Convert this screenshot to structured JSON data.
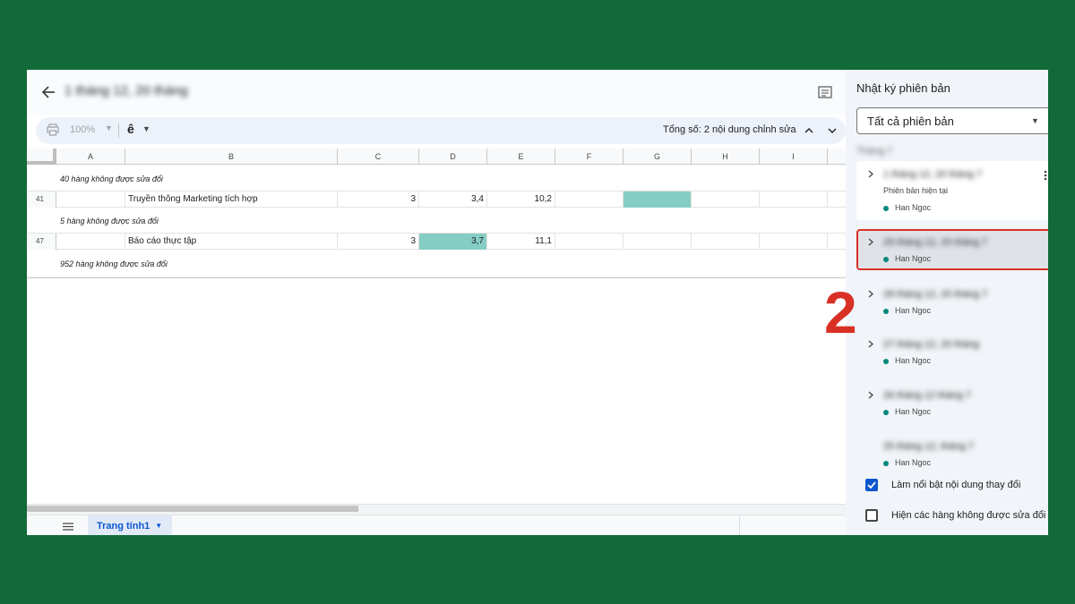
{
  "header": {
    "doc_title": "1 tháng 12, 20 tháng",
    "back_icon": "arrow-left-icon",
    "comment_icon": "comment-icon"
  },
  "toolbar": {
    "zoom": "100%",
    "input_tool": "ê",
    "edit_count": "Tổng số: 2 nội dung chỉnh sửa",
    "print_icon": "print-icon",
    "prev_icon": "chevron-up-icon",
    "next_icon": "chevron-down-icon"
  },
  "grid": {
    "columns": [
      "A",
      "B",
      "C",
      "D",
      "E",
      "F",
      "G",
      "H",
      "I"
    ],
    "notes": [
      "40 hàng không được sửa đổi",
      "5 hàng không được sửa đổi",
      "952 hàng không được sửa đổi"
    ],
    "rows": [
      {
        "num": "41",
        "b": "Truyền thông Marketing tích hợp",
        "c": "3",
        "d": "3,4",
        "e": "10,2"
      },
      {
        "num": "47",
        "b": "Báo cáo thực tập",
        "c": "3",
        "d": "3,7",
        "e": "11,1"
      }
    ],
    "highlight_color": "#86cdc4"
  },
  "sheetbar": {
    "tab_label": "Trang tính1",
    "menu_icon": "hamburger-menu-icon"
  },
  "panel": {
    "title": "Nhật ký phiên bản",
    "filter": "Tất cả phiên bản",
    "group_label": "Tháng 7",
    "versions": [
      {
        "title": "1 tháng 12, 20 tháng 7",
        "subtitle": "Phiên bản hiện tại",
        "author": "Han Ngoc"
      },
      {
        "title": "29 tháng 12, 20 tháng 7",
        "author": "Han Ngoc"
      },
      {
        "title": "28 tháng 12, 20 tháng 7",
        "author": "Han Ngoc"
      },
      {
        "title": "27 tháng 12, 20 tháng",
        "author": "Han Ngoc"
      },
      {
        "title": "26 tháng 12 tháng 7",
        "author": "Han Ngoc"
      },
      {
        "title": "25 tháng 12, tháng 7",
        "author": "Han Ngoc"
      }
    ],
    "highlight_changes": "Làm nổi bật nội dung thay đổi",
    "show_unchanged": "Hiện các hàng không được sửa đổi",
    "selected_border_color": "#d93025"
  },
  "annotation": {
    "step_number": "2",
    "color": "#d93025"
  }
}
